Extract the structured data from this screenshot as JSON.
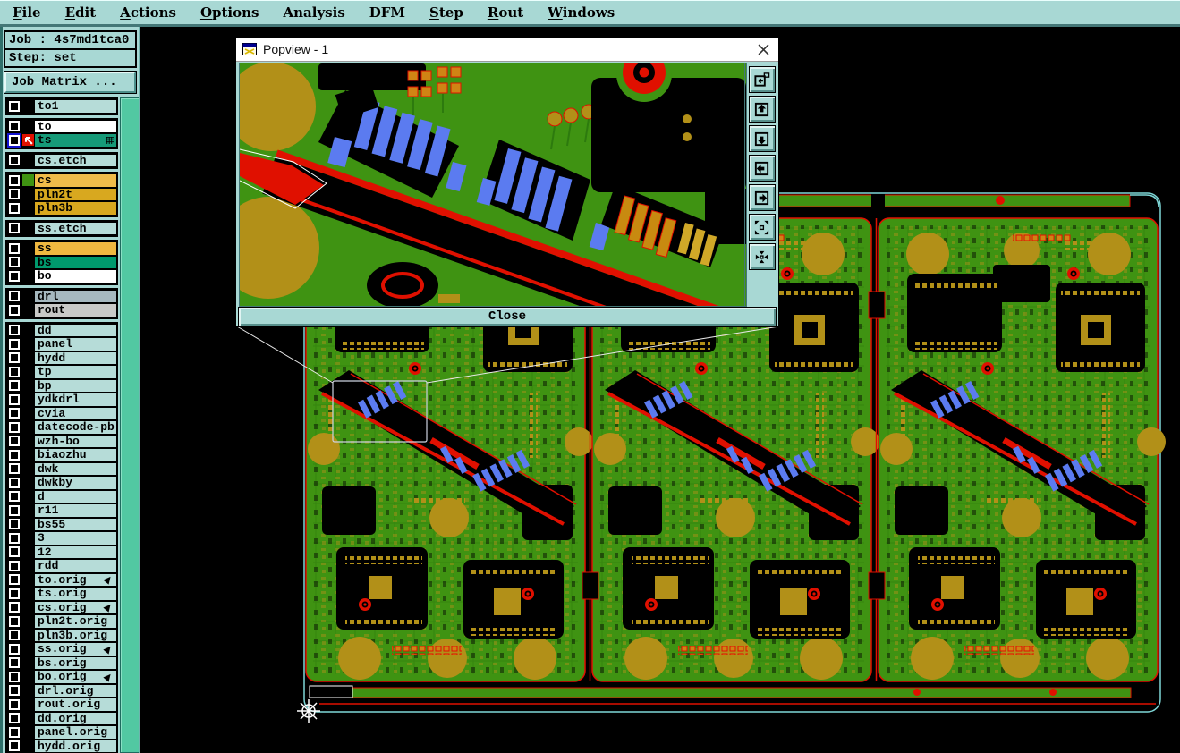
{
  "menu": {
    "items": [
      {
        "label": "File",
        "mnemonic": "F"
      },
      {
        "label": "Edit",
        "mnemonic": "E"
      },
      {
        "label": "Actions",
        "mnemonic": "A"
      },
      {
        "label": "Options",
        "mnemonic": "O"
      },
      {
        "label": "Analysis",
        "mnemonic": ""
      },
      {
        "label": "DFM",
        "mnemonic": ""
      },
      {
        "label": "Step",
        "mnemonic": "S"
      },
      {
        "label": "Rout",
        "mnemonic": "R"
      },
      {
        "label": "Windows",
        "mnemonic": "W"
      }
    ]
  },
  "sidebar": {
    "job_label": "Job :",
    "job_value": "4s7md1tca0",
    "step_label": "Step:",
    "step_value": "set",
    "job_matrix_button": "Job Matrix ...",
    "layer_groups": [
      {
        "rows": [
          {
            "name": "to1",
            "bg": "#b6dcd8"
          }
        ]
      },
      {
        "rows": [
          {
            "name": "to",
            "bg": "#ffffff"
          },
          {
            "name": "ts",
            "bg": "#169a78",
            "active": true,
            "grid_icon": true,
            "swatch": "#e01000"
          }
        ]
      },
      {
        "rows": [
          {
            "name": "cs.etch",
            "bg": "#b6dcd8"
          }
        ]
      },
      {
        "rows": [
          {
            "name": "cs",
            "bg": "#f0bc4a",
            "swatch": "#3f9312"
          },
          {
            "name": "pln2t",
            "bg": "#d8a81f"
          },
          {
            "name": "pln3b",
            "bg": "#d8a81f"
          }
        ]
      },
      {
        "rows": [
          {
            "name": "ss.etch",
            "bg": "#b6dcd8"
          }
        ]
      },
      {
        "rows": [
          {
            "name": "ss",
            "bg": "#f0b840"
          },
          {
            "name": "bs",
            "bg": "#00996d"
          },
          {
            "name": "bo",
            "bg": "#ffffff"
          }
        ]
      },
      {
        "rows": [
          {
            "name": "drl",
            "bg": "#a6b8bf"
          },
          {
            "name": "rout",
            "bg": "#c9c9c7"
          }
        ]
      },
      {
        "rows": [
          {
            "name": "dd",
            "bg": "#b6dcd8"
          },
          {
            "name": "panel",
            "bg": "#b6dcd8"
          },
          {
            "name": "hydd",
            "bg": "#b6dcd8"
          },
          {
            "name": "tp",
            "bg": "#b6dcd8"
          },
          {
            "name": "bp",
            "bg": "#b6dcd8"
          },
          {
            "name": "ydkdrl",
            "bg": "#b6dcd8"
          },
          {
            "name": "cvia",
            "bg": "#b6dcd8"
          },
          {
            "name": "datecode-pb",
            "bg": "#b6dcd8"
          },
          {
            "name": "wzh-bo",
            "bg": "#b6dcd8"
          },
          {
            "name": "biaozhu",
            "bg": "#b6dcd8"
          },
          {
            "name": "dwk",
            "bg": "#b6dcd8"
          },
          {
            "name": "dwkby",
            "bg": "#b6dcd8"
          },
          {
            "name": "d",
            "bg": "#b6dcd8"
          },
          {
            "name": "r11",
            "bg": "#b6dcd8"
          },
          {
            "name": "bs55",
            "bg": "#b6dcd8"
          },
          {
            "name": "3",
            "bg": "#b6dcd8"
          },
          {
            "name": "12",
            "bg": "#b6dcd8"
          },
          {
            "name": "rdd",
            "bg": "#b6dcd8"
          },
          {
            "name": "to.orig",
            "bg": "#b6dcd8",
            "attached": true
          },
          {
            "name": "ts.orig",
            "bg": "#b6dcd8"
          },
          {
            "name": "cs.orig",
            "bg": "#b6dcd8",
            "attached": true
          },
          {
            "name": "pln2t.orig",
            "bg": "#b6dcd8"
          },
          {
            "name": "pln3b.orig",
            "bg": "#b6dcd8"
          },
          {
            "name": "ss.orig",
            "bg": "#b6dcd8",
            "attached": true
          },
          {
            "name": "bs.orig",
            "bg": "#b6dcd8"
          },
          {
            "name": "bo.orig",
            "bg": "#b6dcd8",
            "attached": true
          },
          {
            "name": "drl.orig",
            "bg": "#b6dcd8"
          },
          {
            "name": "rout.orig",
            "bg": "#b6dcd8"
          },
          {
            "name": "dd.orig",
            "bg": "#b6dcd8"
          },
          {
            "name": "panel.orig",
            "bg": "#b6dcd8"
          },
          {
            "name": "hydd.orig",
            "bg": "#b6dcd8",
            "partial": true
          }
        ]
      }
    ]
  },
  "popview": {
    "title": "Popview - 1",
    "close_button": "Close",
    "toolbar": [
      {
        "name": "overview-button",
        "icon": "window-export-icon"
      },
      {
        "name": "pan-up-button",
        "icon": "arrow-up-icon"
      },
      {
        "name": "pan-down-button",
        "icon": "arrow-down-icon"
      },
      {
        "name": "pan-left-button",
        "icon": "arrow-left-icon"
      },
      {
        "name": "pan-right-button",
        "icon": "arrow-right-icon"
      },
      {
        "name": "expand-view-button",
        "icon": "arrows-out-icon"
      },
      {
        "name": "center-view-button",
        "icon": "arrows-in-icon"
      }
    ]
  },
  "colors": {
    "ui_teal": "#a8d8d4",
    "board_green": "#3f9312",
    "pad_olive": "#b29018",
    "trace_red": "#e81000",
    "component_blue": "#5b7bf0",
    "outline_cyan": "#7fd8d8",
    "scrollbar_green": "#52c8a2",
    "active_layer_green": "#169a78"
  }
}
